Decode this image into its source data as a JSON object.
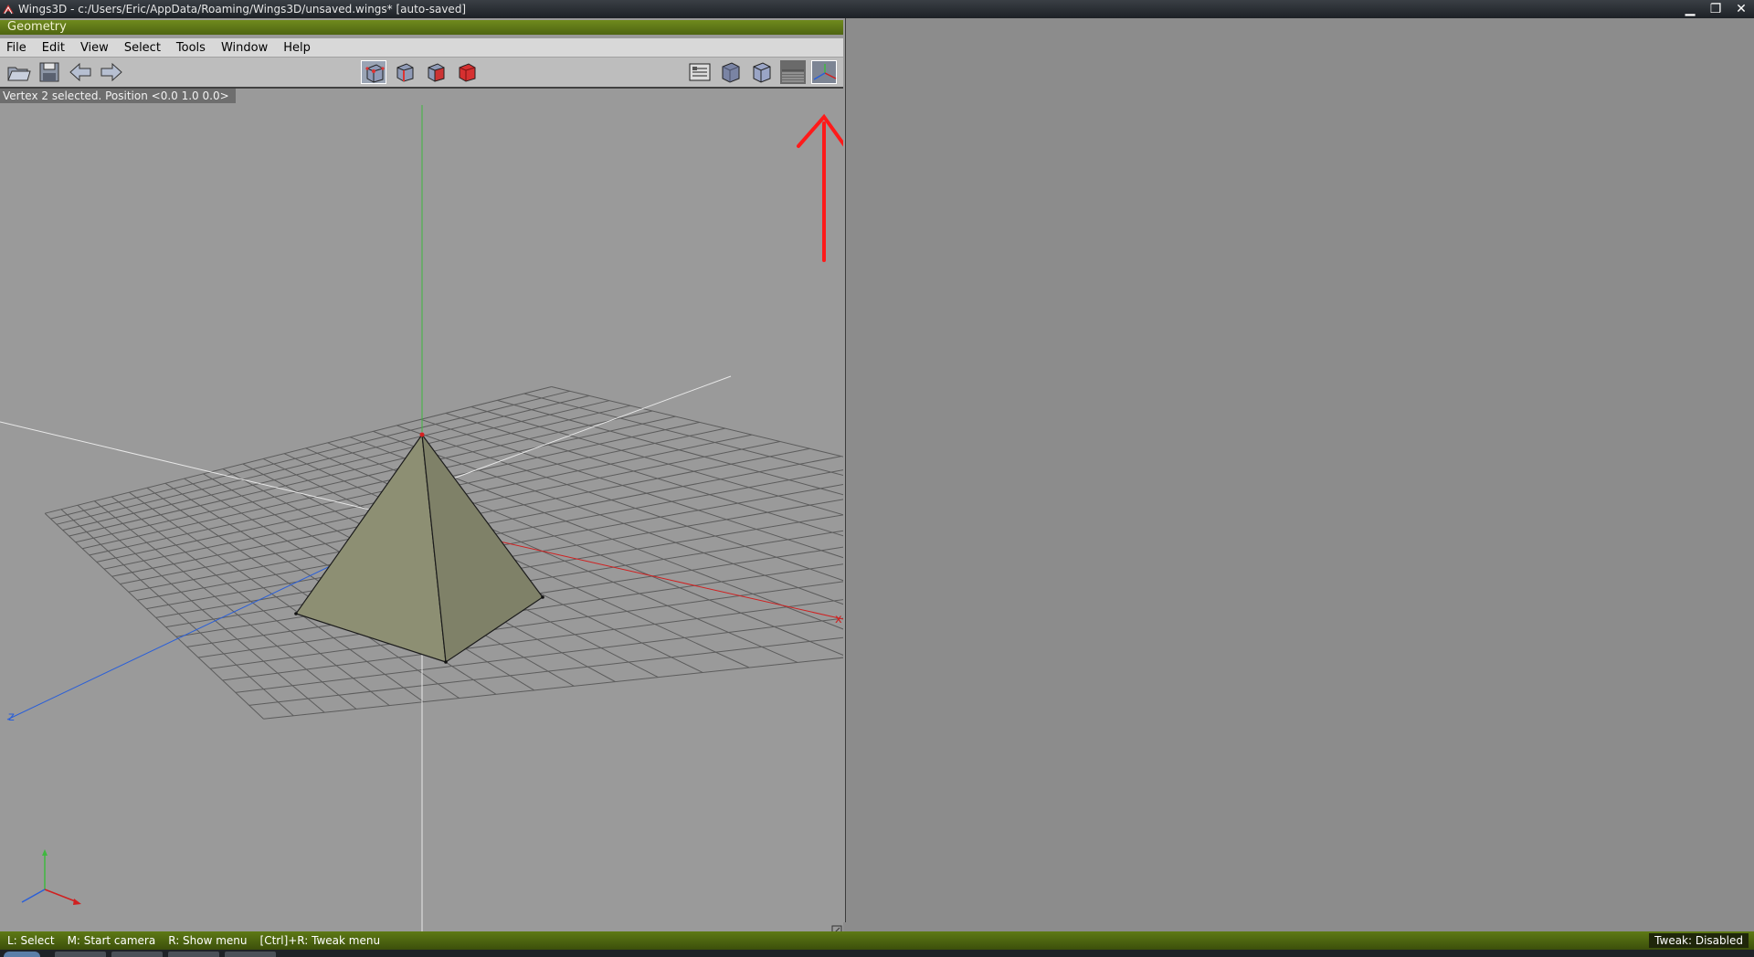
{
  "window": {
    "title": "Wings3D - c:/Users/Eric/AppData/Roaming/Wings3D/unsaved.wings* [auto-saved]",
    "controls": {
      "minimize": "▁",
      "restore": "❐",
      "close": "✕"
    }
  },
  "geometry_window": {
    "title": "Geometry",
    "menu": [
      "File",
      "Edit",
      "View",
      "Select",
      "Tools",
      "Window",
      "Help"
    ],
    "status": "Vertex 2 selected. Position <0.0  1.0  0.0>",
    "axis_label_x": "x",
    "axis_label_z": "z"
  },
  "toolbar": {
    "left_icons": [
      "open-folder-icon",
      "save-disk-icon",
      "undo-arrow-icon",
      "redo-arrow-icon"
    ],
    "select_mode_icons": [
      "vertex-mode-icon",
      "edge-mode-icon",
      "face-mode-icon",
      "body-mode-icon"
    ],
    "selected_mode": "vertex-mode-icon",
    "right_icons": [
      "workmode-toggle-icon",
      "smooth-shading-icon",
      "flat-shading-icon",
      "ortho-grid-icon",
      "show-axes-icon"
    ]
  },
  "bottom_bar": {
    "hints": [
      "L: Select",
      "M: Start camera",
      "R: Show menu",
      "[Ctrl]+R: Tweak menu"
    ],
    "tweak_status": "Tweak: Disabled"
  },
  "colors": {
    "accent_green": "#5e7a15",
    "annotation_red": "#ff1a1a",
    "x_axis": "#d02020",
    "y_axis": "#3fb83f",
    "z_axis": "#2a5fd8"
  }
}
